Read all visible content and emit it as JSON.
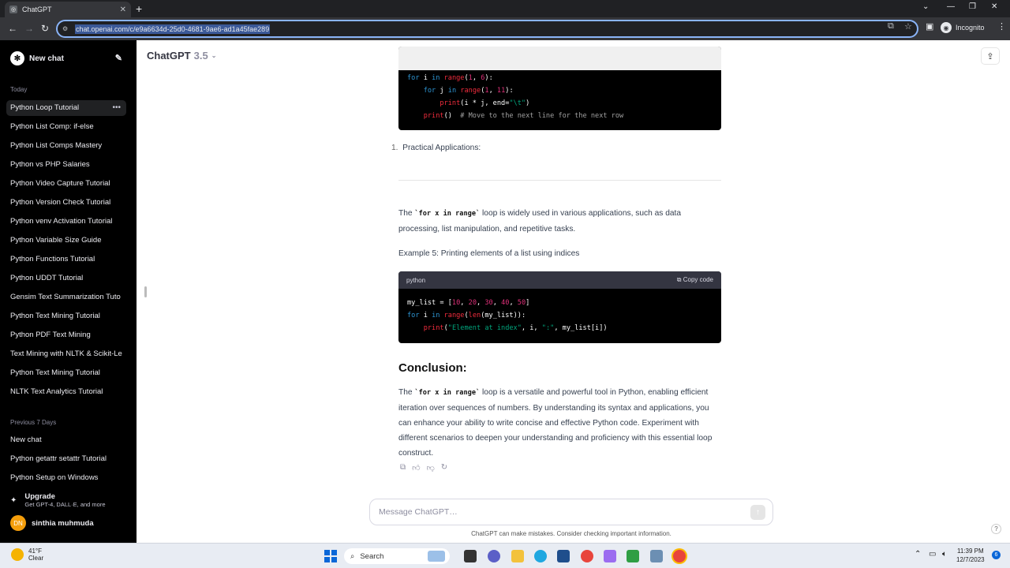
{
  "browser": {
    "tab_title": "ChatGPT",
    "url": "chat.openai.com/c/e9a6634d-25d0-4681-9ae6-ad1a45fae289",
    "profile_label": "Incognito"
  },
  "sidebar": {
    "new_chat": "New chat",
    "section_today": "Today",
    "today_items": [
      "Python Loop Tutorial",
      "Python List Comp: if-else",
      "Python List Comps Mastery",
      "Python vs PHP Salaries",
      "Python Video Capture Tutorial",
      "Python Version Check Tutorial",
      "Python venv Activation Tutorial",
      "Python Variable Size Guide",
      "Python Functions Tutorial",
      "Python UDDT Tutorial",
      "Gensim Text Summarization Tuto",
      "Python Text Mining Tutorial",
      "Python PDF Text Mining",
      "Text Mining with NLTK & Scikit-Le",
      "Python Text Mining Tutorial",
      "NLTK Text Analytics Tutorial"
    ],
    "section_prev7": "Previous 7 Days",
    "prev7_items": [
      "New chat",
      "Python getattr setattr Tutorial",
      "Python Setup on Windows"
    ],
    "upgrade_title": "Upgrade",
    "upgrade_sub": "Get GPT-4, DALL·E, and more",
    "user_initials": "DN",
    "user_name": "sinthia muhmuda"
  },
  "header": {
    "model": "ChatGPT",
    "version": "3.5"
  },
  "content": {
    "list_marker": "1.",
    "practical": "Practical Applications:",
    "para1_pre": "The ",
    "inline_code": "`for x in range`",
    "para1_post": " loop is widely used in various applications, such as data processing, list manipulation, and repetitive tasks.",
    "example5": "Example 5: Printing elements of a list using indices",
    "code_lang": "python",
    "copy_code": "Copy code",
    "conclusion": "Conclusion:",
    "para2_pre": "The ",
    "para2_post": " loop is a versatile and powerful tool in Python, enabling efficient iteration over sequences of numbers. By understanding its syntax and applications, you can enhance your ability to write concise and effective Python code. Experiment with different scenarios to deepen your understanding and proficiency with this essential loop construct."
  },
  "composer": {
    "placeholder": "Message ChatGPT…",
    "disclaimer": "ChatGPT can make mistakes. Consider checking important information."
  },
  "taskbar": {
    "temp": "41°F",
    "weather": "Clear",
    "search": "Search",
    "time": "11:39 PM",
    "date": "12/7/2023",
    "notifications": "6"
  }
}
